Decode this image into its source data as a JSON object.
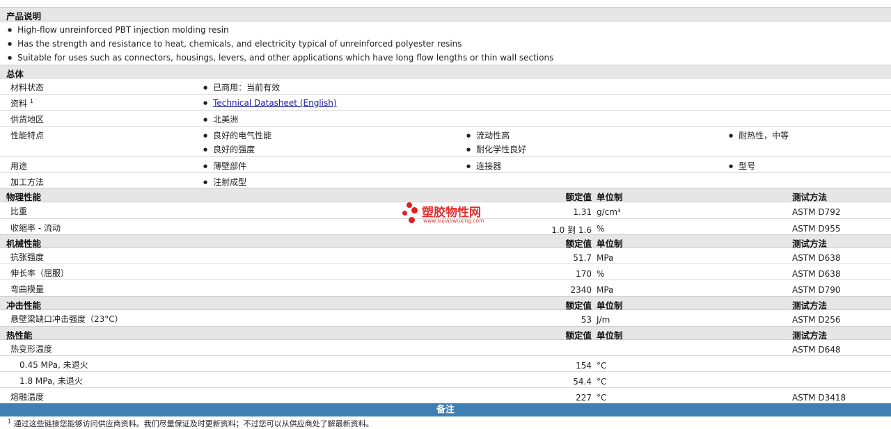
{
  "product_description": {
    "heading": "产品说明",
    "bullets": [
      "High-flow unreinforced PBT injection molding resin",
      "Has the strength and resistance to heat, chemicals, and electricity typical of unreinforced polyester resins",
      "Suitable for uses such as connectors, housings, levers, and other applications which have long flow lengths or thin wall sections"
    ]
  },
  "general": {
    "heading": "总体",
    "material_status_label": "材料状态",
    "material_status": "已商用：当前有效",
    "literature_label": "资料",
    "literature_sup": "1",
    "literature_link": "Technical Datasheet (English)",
    "supply_region_label": "供货地区",
    "supply_region": "北美洲",
    "features_label": "性能特点",
    "features": [
      "良好的电气性能",
      "流动性高",
      "耐热性，中等",
      "良好的强度",
      "耐化学性良好"
    ],
    "uses_label": "用途",
    "uses": [
      "薄壁部件",
      "连接器",
      "型号"
    ],
    "processing_label": "加工方法",
    "processing": "注射成型"
  },
  "columns": {
    "nominal": "额定值",
    "unit": "单位制",
    "method": "测试方法"
  },
  "physical": {
    "heading": "物理性能",
    "rows": [
      {
        "label": "比重",
        "value": "1.31",
        "unit": "g/cm³",
        "method": "ASTM D792"
      },
      {
        "label": "收缩率 - 流动",
        "value": "1.0 到  1.6",
        "unit": "%",
        "method": "ASTM D955"
      }
    ]
  },
  "mechanical": {
    "heading": "机械性能",
    "rows": [
      {
        "label": "抗张强度",
        "value": "51.7",
        "unit": "MPa",
        "method": "ASTM D638"
      },
      {
        "label": "伸长率（屈服）",
        "value": "170",
        "unit": "%",
        "method": "ASTM D638"
      },
      {
        "label": "弯曲模量",
        "value": "2340",
        "unit": "MPa",
        "method": "ASTM D790"
      }
    ]
  },
  "impact": {
    "heading": "冲击性能",
    "rows": [
      {
        "label": "悬壁梁缺口冲击强度（23°C）",
        "value": "53",
        "unit": "J/m",
        "method": "ASTM D256"
      }
    ]
  },
  "thermal": {
    "heading": "热性能",
    "hdt_label": "热变形温度",
    "hdt_method": "ASTM D648",
    "rows": [
      {
        "label": "0.45 MPa, 未退火",
        "value": "154",
        "unit": "°C"
      },
      {
        "label": "1.8 MPa, 未退火",
        "value": "54.4",
        "unit": "°C"
      }
    ],
    "melt_label": "熔融温度",
    "melt_value": "227",
    "melt_unit": "°C",
    "melt_method": "ASTM D3418"
  },
  "notes_bar": "备注",
  "footnote_num": "1",
  "footnote": "通过这些链接您能够访问供应商资料。我们尽量保证及时更新资料；不过您可以从供应商处了解最新资料。",
  "watermark": {
    "title": "塑胶物性网",
    "subtitle": "www.sujiaowuxing.com"
  }
}
